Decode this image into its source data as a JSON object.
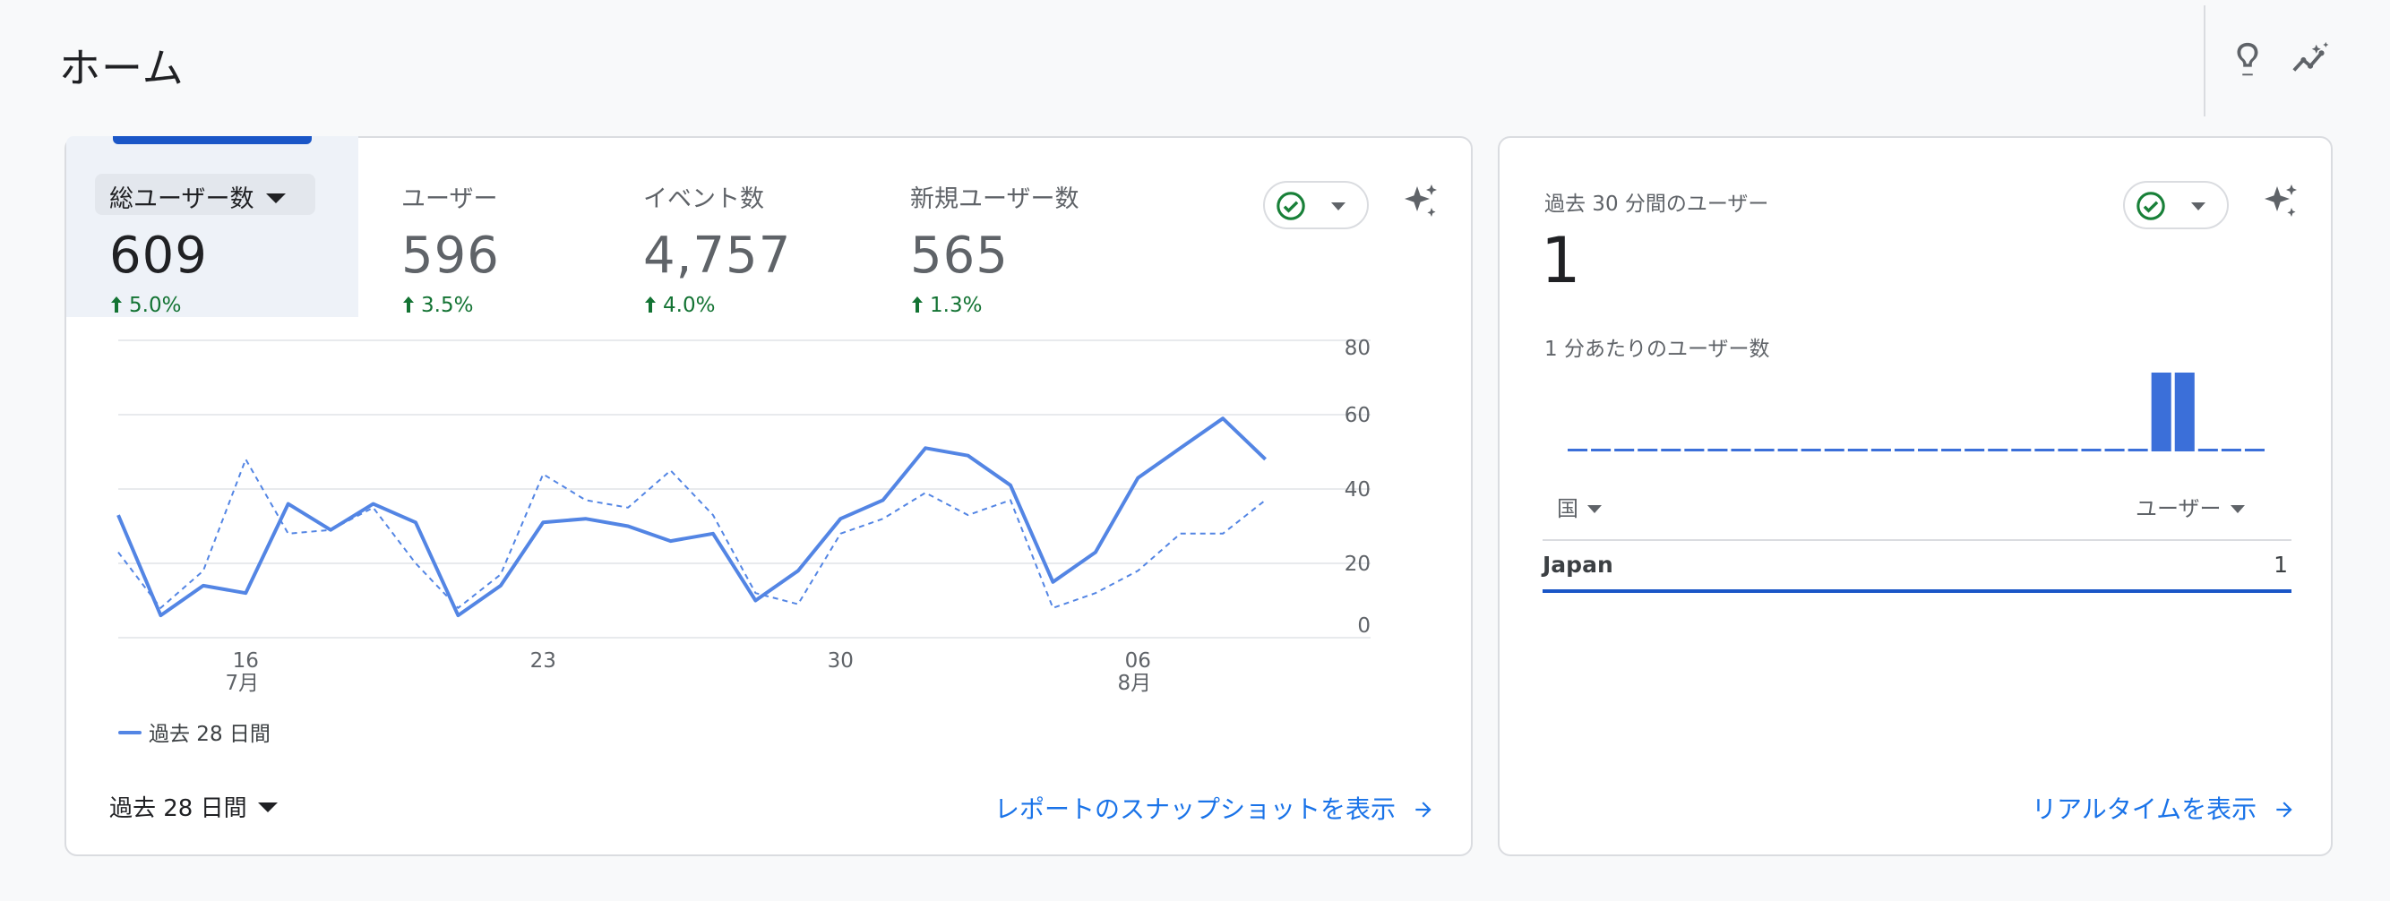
{
  "page": {
    "title": "ホーム",
    "header_icons": [
      "lightbulb-icon",
      "insights-icon"
    ]
  },
  "overview": {
    "metrics": [
      {
        "label": "総ユーザー数",
        "value": "609",
        "change": "5.0%",
        "active": true
      },
      {
        "label": "ユーザー",
        "value": "596",
        "change": "3.5%",
        "active": false
      },
      {
        "label": "イベント数",
        "value": "4,757",
        "change": "4.0%",
        "active": false
      },
      {
        "label": "新規ユーザー数",
        "value": "565",
        "change": "1.3%",
        "active": false
      }
    ],
    "legend_label": "過去 28 日間",
    "date_range": "過去 28 日間",
    "link_text": "レポートのスナップショットを表示"
  },
  "chart_data": {
    "type": "line",
    "x": [
      "07-13",
      "07-14",
      "07-15",
      "07-16",
      "07-17",
      "07-18",
      "07-19",
      "07-20",
      "07-21",
      "07-22",
      "07-23",
      "07-24",
      "07-25",
      "07-26",
      "07-27",
      "07-28",
      "07-29",
      "07-30",
      "07-31",
      "08-01",
      "08-02",
      "08-03",
      "08-04",
      "08-05",
      "08-06",
      "08-07",
      "08-08",
      "08-09",
      "08-10"
    ],
    "x_tick_labels": [
      {
        "x": "07-16",
        "label": "16",
        "sublabel": "7月"
      },
      {
        "x": "07-23",
        "label": "23",
        "sublabel": ""
      },
      {
        "x": "07-30",
        "label": "30",
        "sublabel": ""
      },
      {
        "x": "08-06",
        "label": "06",
        "sublabel": "8月"
      }
    ],
    "series": [
      {
        "name": "過去 28 日間",
        "style": "solid",
        "color": "#5385e4",
        "values": [
          33,
          6,
          14,
          12,
          36,
          29,
          36,
          31,
          6,
          14,
          31,
          32,
          30,
          26,
          28,
          10,
          18,
          32,
          37,
          51,
          49,
          41,
          15,
          23,
          43,
          51,
          59,
          48
        ]
      },
      {
        "name": "",
        "style": "dashed",
        "color": "#5385e4",
        "values": [
          23,
          8,
          18,
          48,
          28,
          29,
          35,
          20,
          8,
          17,
          44,
          37,
          35,
          45,
          33,
          12,
          9,
          28,
          32,
          39,
          33,
          37,
          8,
          12,
          18,
          28,
          28,
          37
        ]
      }
    ],
    "ylim": [
      0,
      80
    ],
    "y_ticks": [
      0,
      20,
      40,
      60,
      80
    ],
    "grid": true,
    "title": "",
    "xlabel": "",
    "ylabel": ""
  },
  "realtime": {
    "label": "過去 30 分間のユーザー",
    "value": "1",
    "sub_label": "1 分あたりのユーザー数",
    "bars": [
      0,
      0,
      0,
      0,
      0,
      0,
      0,
      0,
      0,
      0,
      0,
      0,
      0,
      0,
      0,
      0,
      0,
      0,
      0,
      0,
      0,
      0,
      0,
      0,
      0,
      1,
      1,
      0,
      0,
      0
    ],
    "col_country": "国",
    "col_users": "ユーザー",
    "rows": [
      {
        "country": "Japan",
        "users": "1"
      }
    ],
    "link_text": "リアルタイムを表示"
  },
  "colors": {
    "accent": "#1a73e8",
    "positive": "#137333",
    "line": "#5385e4",
    "tab_indicator": "#1a56c7"
  }
}
